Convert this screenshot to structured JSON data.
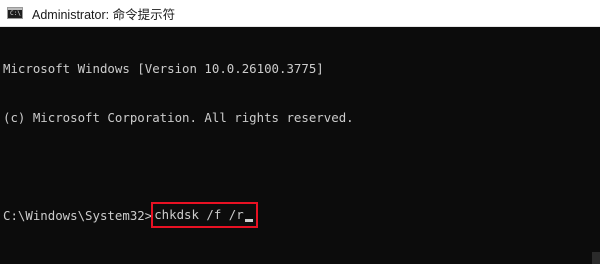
{
  "window": {
    "title": "Administrator: 命令提示符",
    "icon": "cmd-console-icon",
    "icon_text": "C:\\"
  },
  "console": {
    "lines": [
      "Microsoft Windows [Version 10.0.26100.3775]",
      "(c) Microsoft Corporation. All rights reserved."
    ],
    "prompt": "C:\\Windows\\System32>",
    "command": "chkdsk /f /r"
  },
  "colors": {
    "background": "#0c0c0c",
    "text": "#cccccc",
    "highlight_border": "#e81123",
    "titlebar": "#ffffff"
  }
}
